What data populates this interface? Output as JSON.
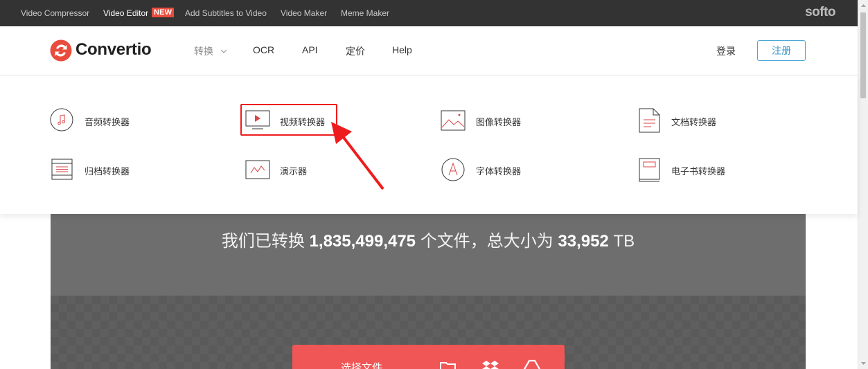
{
  "topbar": {
    "links": [
      {
        "label": "Video Compressor"
      },
      {
        "label": "Video Editor"
      },
      {
        "label": "Add Subtitles to Video"
      },
      {
        "label": "Video Maker"
      },
      {
        "label": "Meme Maker"
      }
    ],
    "new_badge": "NEW",
    "brand": "softo"
  },
  "header": {
    "logo_text": "Convertio",
    "nav": [
      {
        "label": "转换"
      },
      {
        "label": "OCR"
      },
      {
        "label": "API"
      },
      {
        "label": "定价"
      },
      {
        "label": "Help"
      }
    ],
    "login": "登录",
    "register": "注册"
  },
  "menu": {
    "items": [
      {
        "label": "音频转换器",
        "icon": "music-note-icon"
      },
      {
        "label": "视频转换器",
        "icon": "video-play-icon"
      },
      {
        "label": "图像转换器",
        "icon": "image-icon"
      },
      {
        "label": "文档转换器",
        "icon": "document-icon"
      },
      {
        "label": "归档转换器",
        "icon": "archive-icon"
      },
      {
        "label": "演示器",
        "icon": "presentation-chart-icon"
      },
      {
        "label": "字体转换器",
        "icon": "font-letter-a-icon"
      },
      {
        "label": "电子书转换器",
        "icon": "ebook-icon"
      }
    ]
  },
  "hero": {
    "stats_prefix": "我们已转换",
    "files_count": "1,835,499,475",
    "stats_middle": "个文件，总大小为",
    "total_size": "33,952",
    "size_unit": "TB",
    "choose_files": "选择文件"
  },
  "colors": {
    "brand_red": "#e94c3d",
    "button_red": "#f05656",
    "register_blue": "#3e98cc",
    "highlight": "#ee1c1c"
  }
}
